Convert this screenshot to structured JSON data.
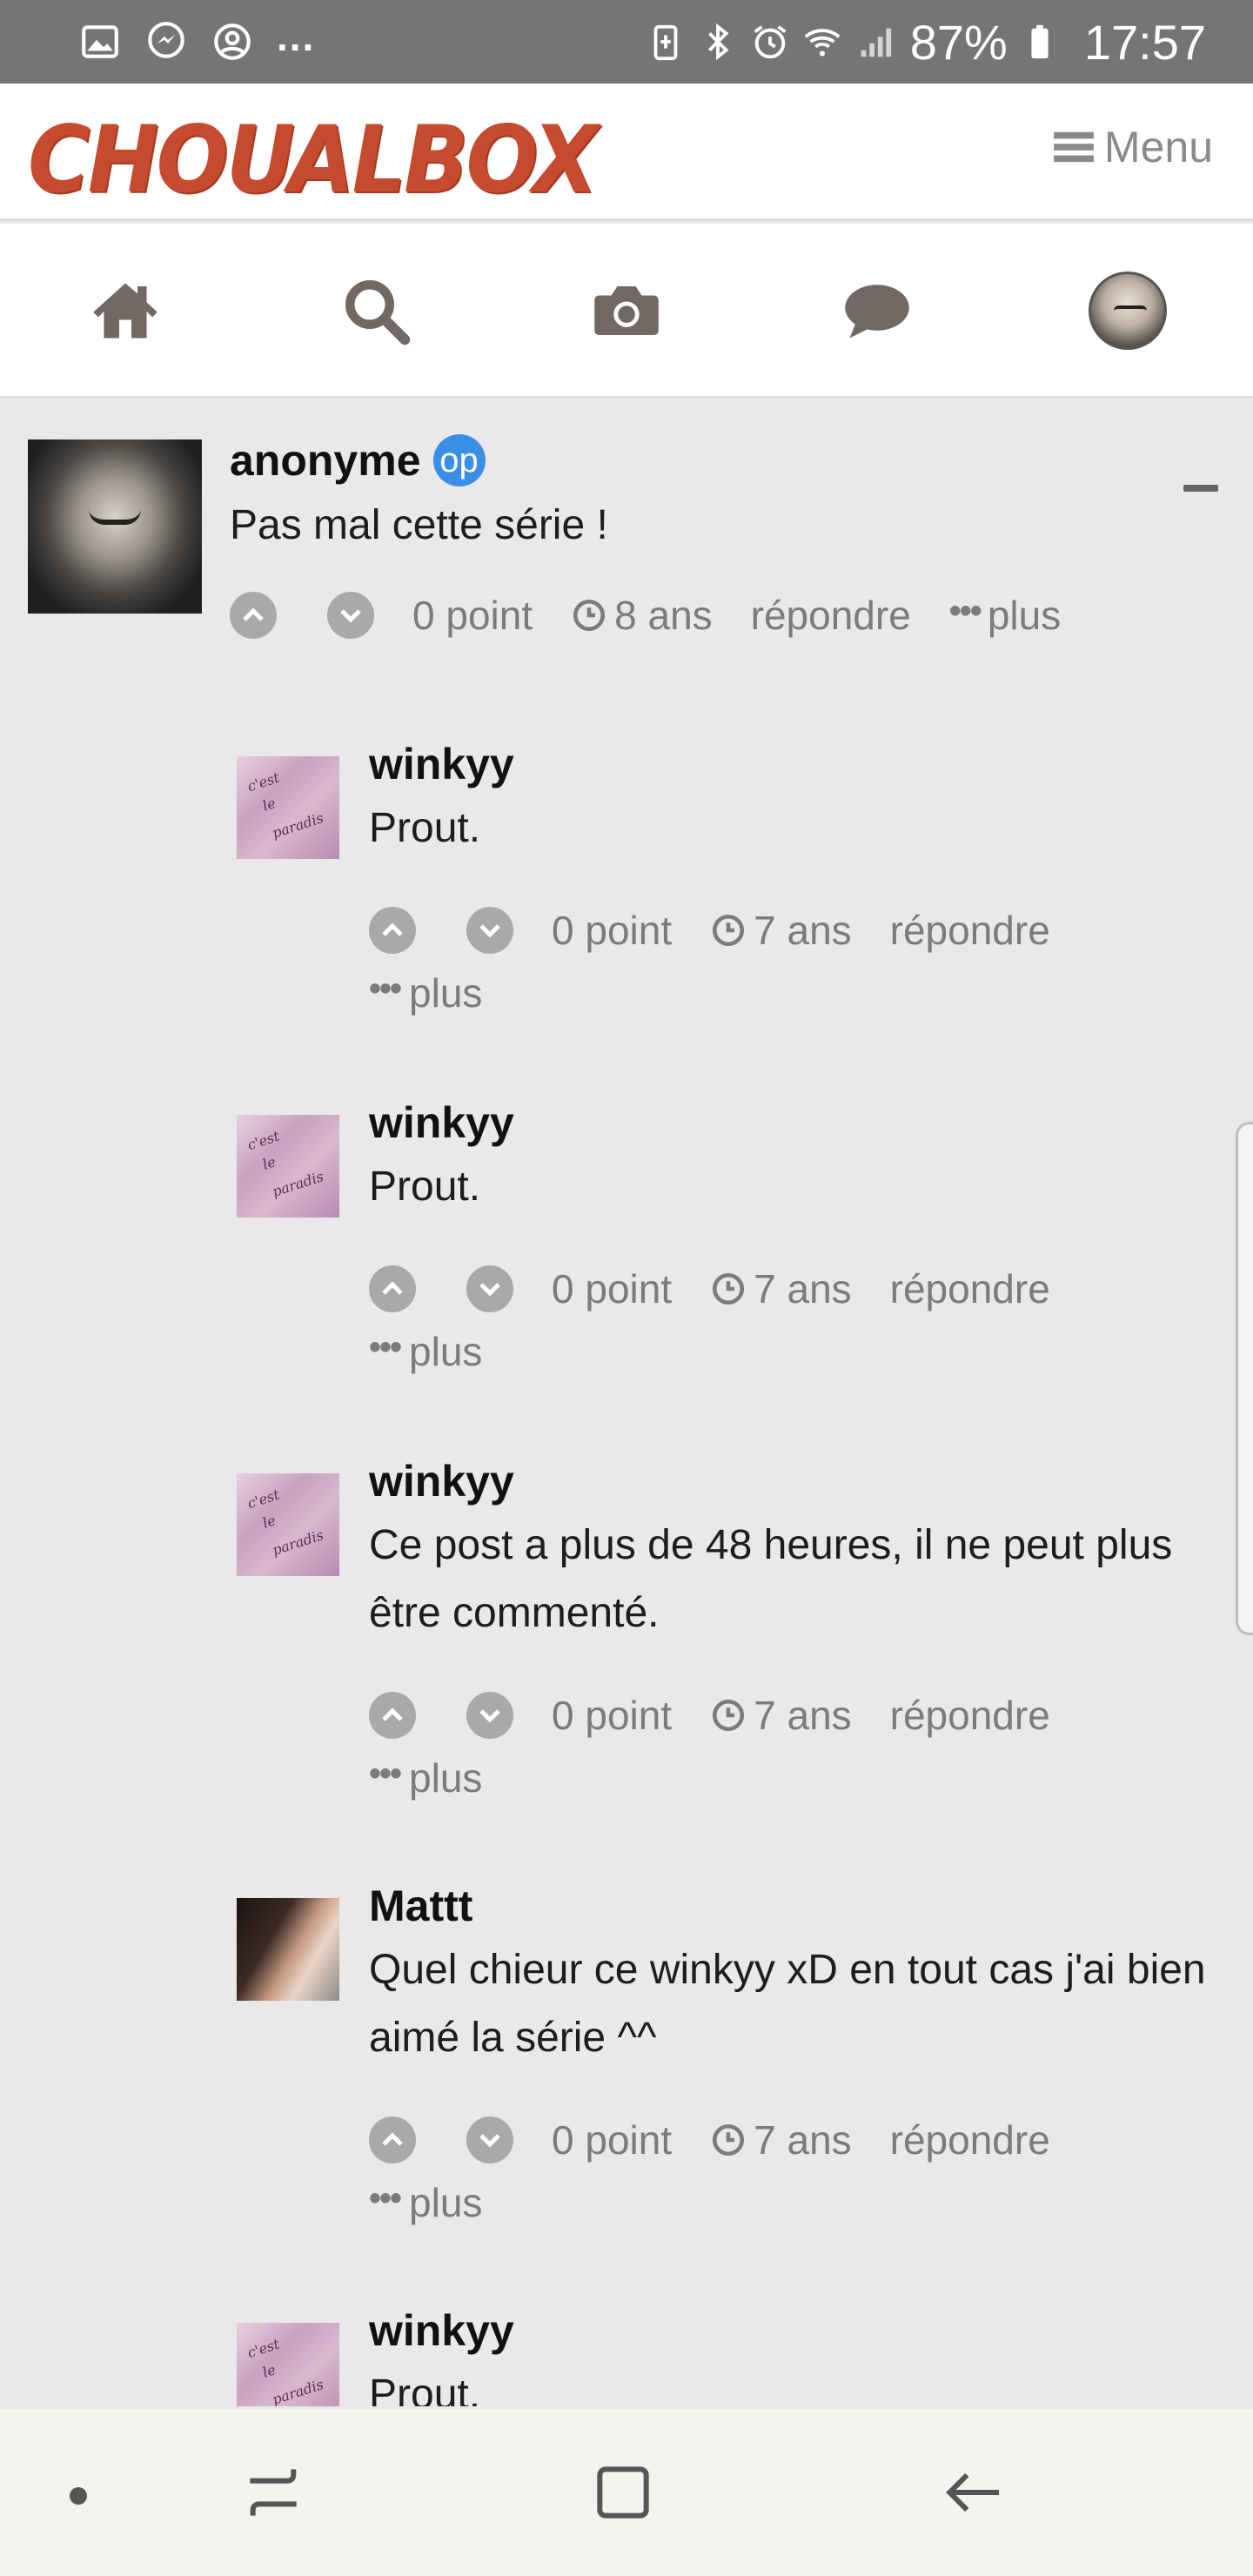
{
  "status_bar": {
    "battery_percent": "87%",
    "time": "17:57",
    "overflow": "...",
    "left_icons": [
      "gallery-icon",
      "messenger-icon",
      "account-icon"
    ],
    "right_icons": [
      "battery-saver-icon",
      "bluetooth-icon",
      "alarm-icon",
      "wifi-icon",
      "signal-icon",
      "battery-icon"
    ]
  },
  "header": {
    "logo": "CHOUALBOX",
    "menu_label": "Menu"
  },
  "navbar": {
    "items": [
      "home-icon",
      "search-icon",
      "camera-icon",
      "chat-icon",
      "profile-avatar"
    ]
  },
  "colors": {
    "logo_red": "#c64a2e",
    "op_badge_blue": "#3b8ee6",
    "page_background": "#e9e9e9",
    "muted_text": "#7b7b7b"
  },
  "comments": [
    {
      "author": "anonyme",
      "badge": "op",
      "text": "Pas mal cette série !",
      "points": "0 point",
      "age": "8 ans",
      "reply": "répondre",
      "more": "plus"
    },
    {
      "author": "winkyy",
      "text": "Prout.",
      "points": "0 point",
      "age": "7 ans",
      "reply": "répondre",
      "more": "plus"
    },
    {
      "author": "winkyy",
      "text": "Prout.",
      "points": "0 point",
      "age": "7 ans",
      "reply": "répondre",
      "more": "plus"
    },
    {
      "author": "winkyy",
      "text": "Ce post a plus de 48 heures, il ne peut plus être commenté.",
      "points": "0 point",
      "age": "7 ans",
      "reply": "répondre",
      "more": "plus"
    },
    {
      "author": "Mattt",
      "text": "Quel chieur ce winkyy xD en tout cas j'ai bien aimé la série ^^",
      "points": "0 point",
      "age": "7 ans",
      "reply": "répondre",
      "more": "plus"
    },
    {
      "author": "winkyy",
      "text": "Prout."
    }
  ]
}
